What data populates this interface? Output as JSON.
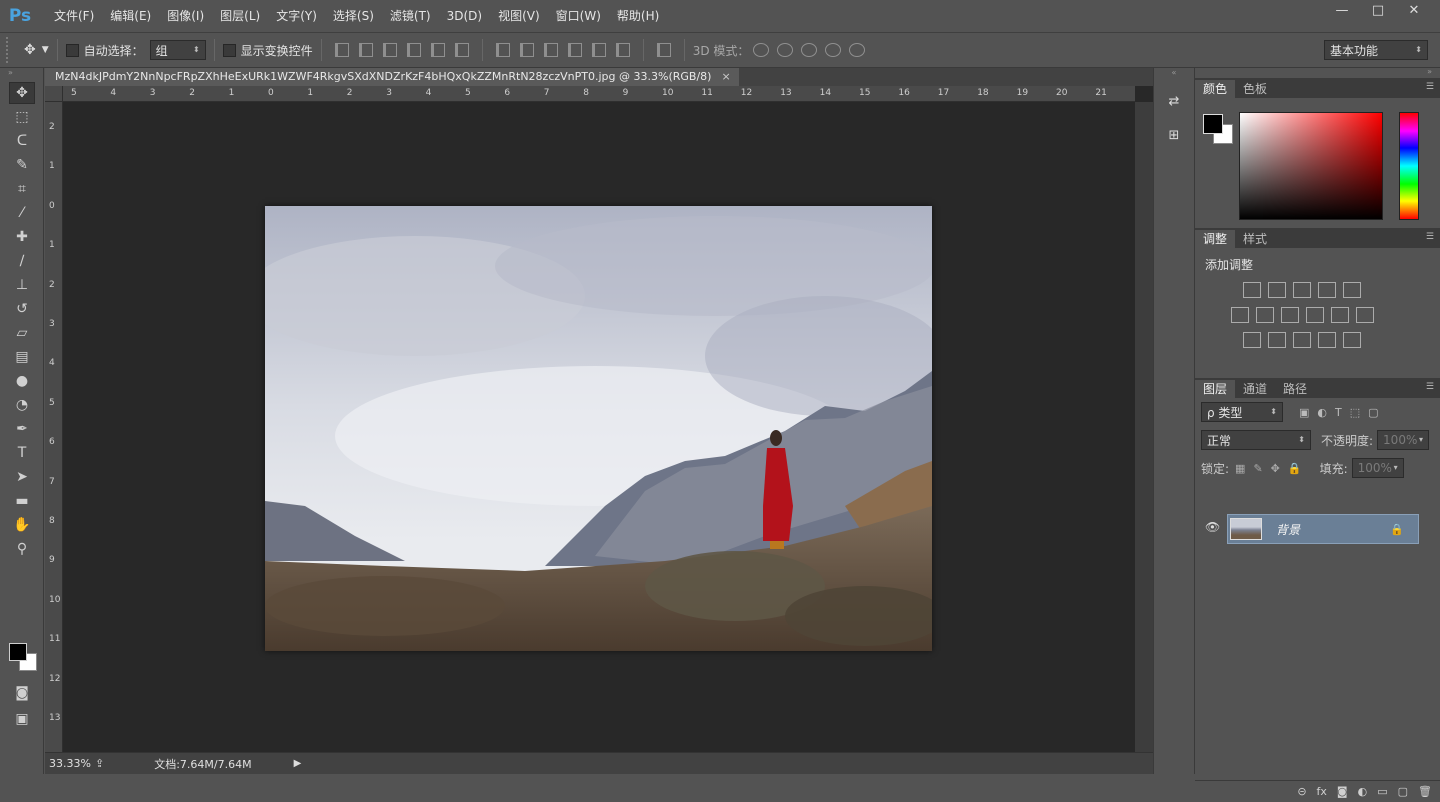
{
  "app": {
    "logo": "Ps"
  },
  "menu": [
    "文件(F)",
    "编辑(E)",
    "图像(I)",
    "图层(L)",
    "文字(Y)",
    "选择(S)",
    "滤镜(T)",
    "3D(D)",
    "视图(V)",
    "窗口(W)",
    "帮助(H)"
  ],
  "window_controls": {
    "minimize": "—",
    "maximize": "□",
    "close": "✕"
  },
  "options": {
    "auto_select_label": "自动选择：",
    "auto_select_value": "组",
    "show_transform_label": "显示变换控件",
    "mode_3d_label": "3D 模式：",
    "workspace": "基本功能"
  },
  "document": {
    "tab_title": "MzN4dkJPdmY2NnNpcFRpZXhHeExURk1WZWF4RkgvSXdXNDZrKzF4bHQxQkZZMnRtN28zczVnPT0.jpg @ 33.3%(RGB/8)",
    "tab_close": "×",
    "ruler_h_labels": [
      "5",
      "4",
      "3",
      "2",
      "1",
      "0",
      "1",
      "2",
      "3",
      "4",
      "5",
      "6",
      "7",
      "8",
      "9",
      "10",
      "11",
      "12",
      "13",
      "14",
      "15",
      "16",
      "17",
      "18",
      "19",
      "20",
      "21"
    ],
    "ruler_v_labels": [
      "2",
      "1",
      "0",
      "1",
      "2",
      "3",
      "4",
      "5",
      "6",
      "7",
      "8",
      "9",
      "10",
      "11",
      "12",
      "13"
    ],
    "zoom": "33.33%",
    "doc_info": "文档:7.64M/7.64M",
    "status_arrow": "▶"
  },
  "panels": {
    "color_tabs": [
      "颜色",
      "色板"
    ],
    "adjust_tabs": [
      "调整",
      "样式"
    ],
    "adjust_title": "添加调整",
    "layers_tabs": [
      "图层",
      "通道",
      "路径"
    ],
    "filter_kind": "ρ 类型",
    "blend_mode": "正常",
    "opacity_label": "不透明度:",
    "opacity_value": "100%",
    "lock_label": "锁定:",
    "fill_label": "填充:",
    "fill_value": "100%",
    "layer_name": "背景",
    "footer_icons": [
      "⊝",
      "fx",
      "◙",
      "◐",
      "▭",
      "▢",
      "🗑"
    ]
  },
  "colors": {
    "foreground": "#000000",
    "background": "#ffffff",
    "layer_selected": "#6a7f96"
  },
  "icons": {
    "tools": [
      "move-tool-icon",
      "marquee-tool-icon",
      "lasso-tool-icon",
      "quick-select-icon",
      "crop-tool-icon",
      "eyedropper-icon",
      "healing-brush-icon",
      "brush-tool-icon",
      "stamp-tool-icon",
      "history-brush-icon",
      "eraser-icon",
      "gradient-icon",
      "blur-icon",
      "dodge-icon",
      "pen-tool-icon",
      "type-tool-icon",
      "path-select-icon",
      "shape-tool-icon",
      "hand-tool-icon",
      "zoom-tool-icon"
    ]
  }
}
